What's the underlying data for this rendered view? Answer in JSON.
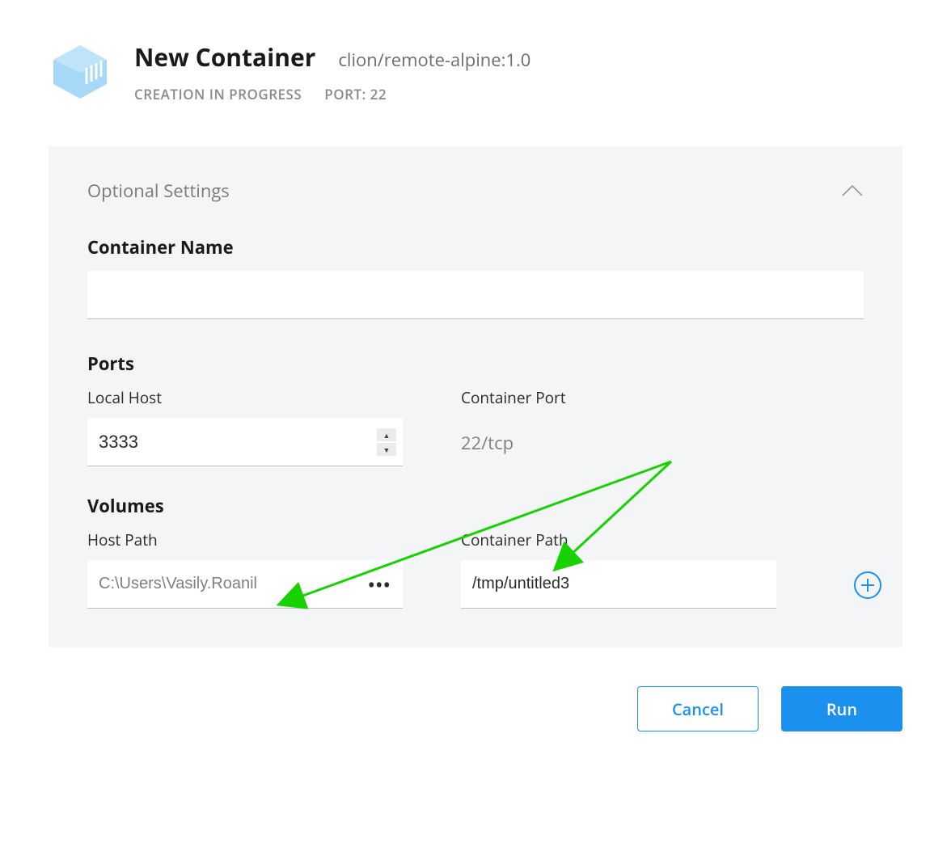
{
  "header": {
    "title": "New Container",
    "image_tag": "clion/remote-alpine:1.0",
    "status": "CREATION IN PROGRESS",
    "port_label": "PORT: 22"
  },
  "panel": {
    "title": "Optional Settings",
    "container_name": {
      "label": "Container Name",
      "value": ""
    },
    "ports": {
      "label": "Ports",
      "local_host_label": "Local Host",
      "local_host_value": "3333",
      "container_port_label": "Container Port",
      "container_port_value": "22/tcp"
    },
    "volumes": {
      "label": "Volumes",
      "host_path_label": "Host Path",
      "host_path_value": "C:\\Users\\Vasily.Roanil",
      "container_path_label": "Container Path",
      "container_path_value": "/tmp/untitled3"
    }
  },
  "footer": {
    "cancel": "Cancel",
    "run": "Run"
  },
  "colors": {
    "accent": "#1c90ed",
    "annotation": "#2ecc40"
  }
}
